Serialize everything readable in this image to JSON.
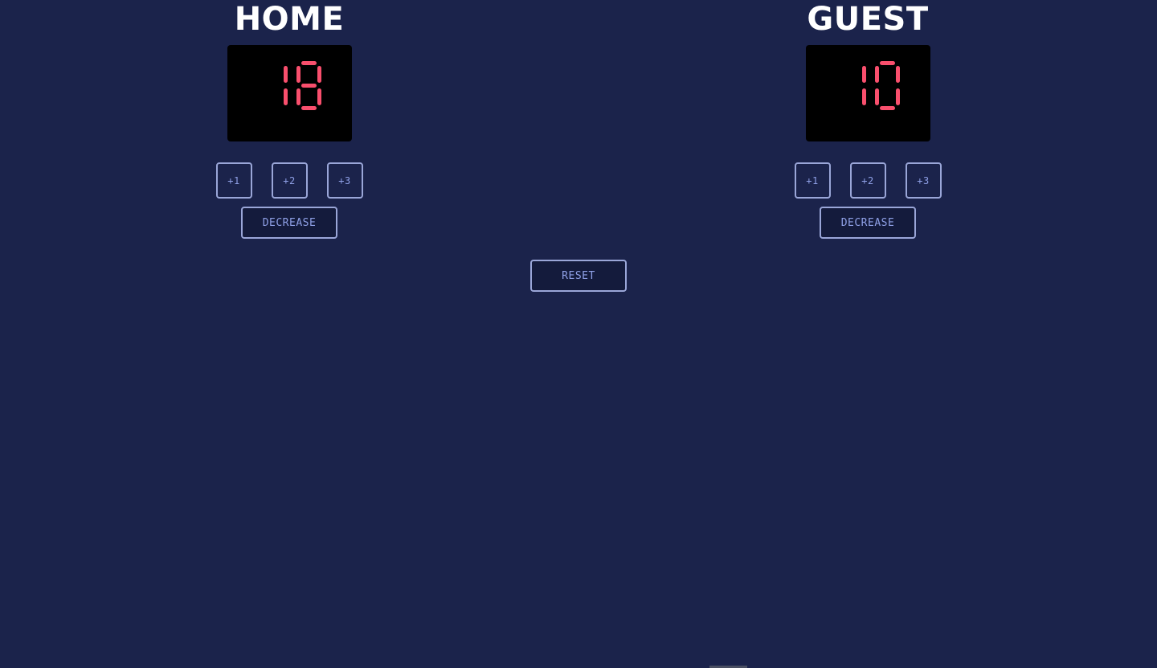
{
  "home": {
    "title": "HOME",
    "score": "18",
    "buttons": {
      "plus1": "+1",
      "plus2": "+2",
      "plus3": "+3",
      "decrease": "DECREASE"
    }
  },
  "guest": {
    "title": "GUEST",
    "score": "10",
    "buttons": {
      "plus1": "+1",
      "plus2": "+2",
      "plus3": "+3",
      "decrease": "DECREASE"
    }
  },
  "controls": {
    "reset": "RESET"
  },
  "colors": {
    "background": "#1b234b",
    "score_digits": "#f94f6d",
    "score_panel": "#000000",
    "button_text": "#8fa0e6",
    "button_border": "#9aa6d8"
  }
}
